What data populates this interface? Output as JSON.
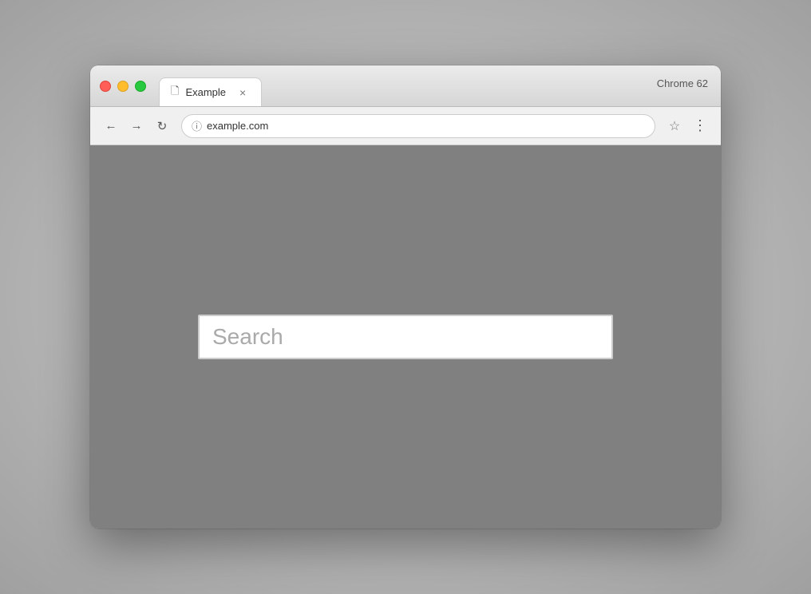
{
  "browser": {
    "chrome_version": "Chrome 62",
    "window_controls": {
      "close_label": "",
      "minimize_label": "",
      "maximize_label": ""
    },
    "tab": {
      "favicon_symbol": "🗋",
      "title": "Example",
      "close_symbol": "×"
    },
    "address_bar": {
      "url": "example.com",
      "info_symbol": "ⓘ"
    },
    "nav": {
      "back_symbol": "←",
      "forward_symbol": "→",
      "reload_symbol": "↻",
      "star_symbol": "☆",
      "menu_symbol": "⋮"
    }
  },
  "page": {
    "search_placeholder": "Search"
  }
}
